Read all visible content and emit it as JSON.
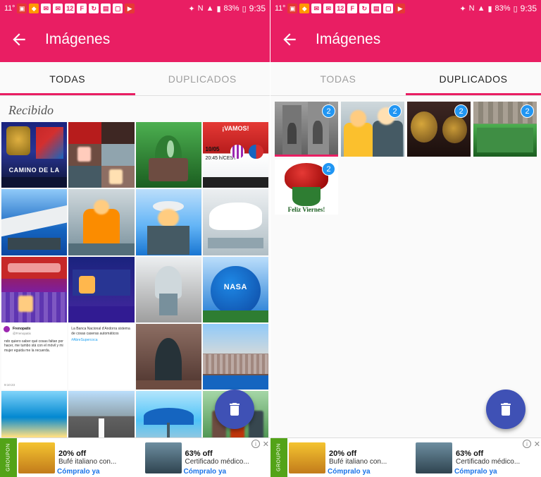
{
  "statusbar": {
    "temperature": "11°",
    "icons_left": [
      "gallery-icon",
      "mail-icon",
      "mail-icon-2",
      "calendar-12-icon",
      "f-icon",
      "sync-icon",
      "chat-icon",
      "camera-icon",
      "youtube-icon"
    ],
    "calendar_day": "12",
    "icons_right": [
      "bluetooth-icon",
      "nfc-icon",
      "wifi-icon",
      "signal-icon"
    ],
    "battery": "83%",
    "clock": "9:35"
  },
  "appbar": {
    "back_label": "back-arrow",
    "title": "Imágenes"
  },
  "tabs": [
    {
      "label": "TODAS",
      "active_left": true,
      "active_right": false
    },
    {
      "label": "DUPLICADOS",
      "active_left": false,
      "active_right": true
    }
  ],
  "left_screen": {
    "section_title": "Recibido",
    "thumbnails": [
      {
        "name": "camino-de-la-trophy",
        "caption": "CAMINO DE LA"
      },
      {
        "name": "collage-faces"
      },
      {
        "name": "plant-cactus"
      },
      {
        "name": "vamos-match-banner",
        "caption": "¡VAMOS!",
        "line2": "10/05",
        "line3": "20:45 h/CEST"
      },
      {
        "name": "airplane-wing"
      },
      {
        "name": "man-orange-shirt"
      },
      {
        "name": "man-hat-boat"
      },
      {
        "name": "airplane-engine"
      },
      {
        "name": "stadium-seats-crowd"
      },
      {
        "name": "museum-interior"
      },
      {
        "name": "rocket-engine-museum"
      },
      {
        "name": "nasa-logo-sphere",
        "caption": "NASA"
      },
      {
        "name": "tweet-screenshot",
        "handle": "Frenopatix",
        "handle_sub": "@Frenopatix",
        "body": "ndo quiero saber qué cosas faltan por hacer, me tumbo stá con el móvil y mi mujer eguida me la recuerda.",
        "time": "9:10:23"
      },
      {
        "name": "tweet-screenshot-2",
        "body": "La Banca Nacional d'Andorra sistema de cosas caseras automáticos",
        "hashtag": "#AbreSupercoca"
      },
      {
        "name": "stone-archway"
      },
      {
        "name": "coastal-city-view"
      },
      {
        "name": "beach-aerial"
      },
      {
        "name": "highway-road"
      },
      {
        "name": "blue-umbrella-beach"
      },
      {
        "name": "group-photo-park"
      },
      {
        "name": "photo-partial"
      }
    ],
    "fab": {
      "name": "delete-fab",
      "icon": "trash-icon"
    }
  },
  "right_screen": {
    "duplicates": [
      {
        "name": "cathedral-facade",
        "badge": "2",
        "selected": true
      },
      {
        "name": "two-people-portrait",
        "badge": "2",
        "selected": false
      },
      {
        "name": "brass-instruments",
        "badge": "2",
        "selected": false
      },
      {
        "name": "roman-baths",
        "badge": "2",
        "selected": false
      },
      {
        "name": "feliz-viernes-roses",
        "badge": "2",
        "selected": false,
        "caption": "Feliz Viernes!"
      }
    ],
    "fab": {
      "name": "delete-fab",
      "icon": "trash-icon"
    }
  },
  "ad": {
    "network_label": "GROUPON",
    "items": [
      {
        "off": "20% off",
        "desc": "Bufé italiano con...",
        "cta": "Cómpralo ya"
      },
      {
        "off": "63% off",
        "desc": "Certificado médico...",
        "cta": "Cómpralo ya"
      }
    ],
    "info_glyph": "i",
    "close_glyph": "✕"
  },
  "colors": {
    "primary": "#e91e63",
    "badge": "#2196f3",
    "fab": "#3f51b5",
    "ad_link": "#1a73e8"
  }
}
